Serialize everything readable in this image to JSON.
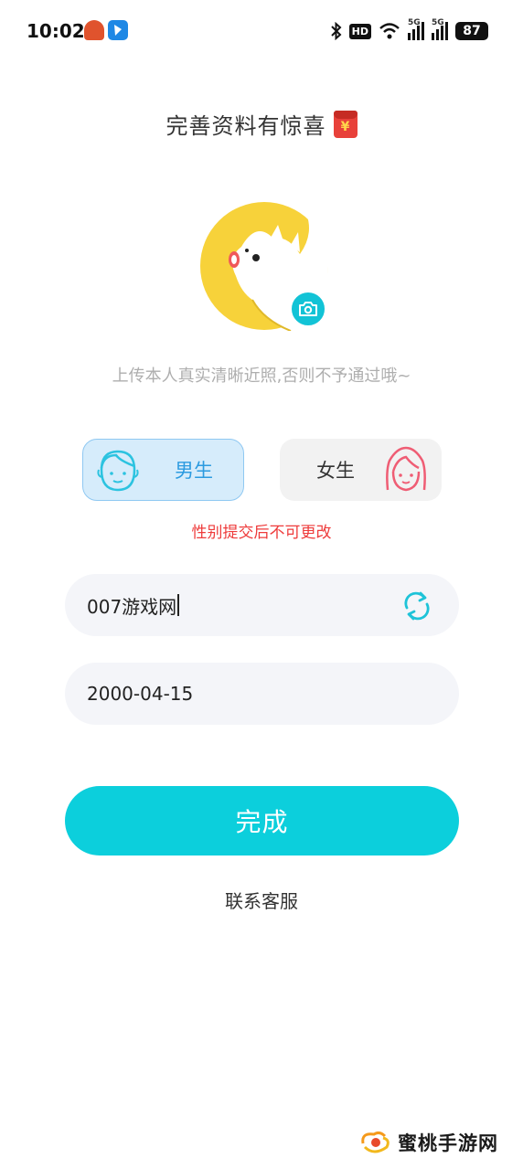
{
  "status_bar": {
    "time": "10:02",
    "hd_label": "HD",
    "network_1": "5G",
    "network_2": "5G",
    "battery": "87",
    "icons": [
      "app-icon-red",
      "app-icon-blue",
      "bluetooth-icon",
      "hd-icon",
      "wifi-icon",
      "signal-icon",
      "signal-icon",
      "battery-icon"
    ]
  },
  "header": {
    "title": "完善资料有惊喜",
    "redpacket_symbol": "¥"
  },
  "avatar": {
    "hint": "上传本人真实清晰近照,否则不予通过哦~"
  },
  "gender": {
    "male_label": "男生",
    "female_label": "女生",
    "selected": "male",
    "note": "性别提交后不可更改"
  },
  "form": {
    "nickname_value": "007游戏网",
    "birthday_value": "2000-04-15"
  },
  "actions": {
    "submit_label": "完成",
    "contact_label": "联系客服"
  },
  "watermark": {
    "text": "蜜桃手游网"
  },
  "colors": {
    "accent": "#0ccfdc",
    "male_bg": "#d6ecfb",
    "male_text": "#2c9be0",
    "female_icon": "#ef5d74",
    "note_red": "#ee3b3b",
    "avatar_yellow": "#f7d23a"
  }
}
